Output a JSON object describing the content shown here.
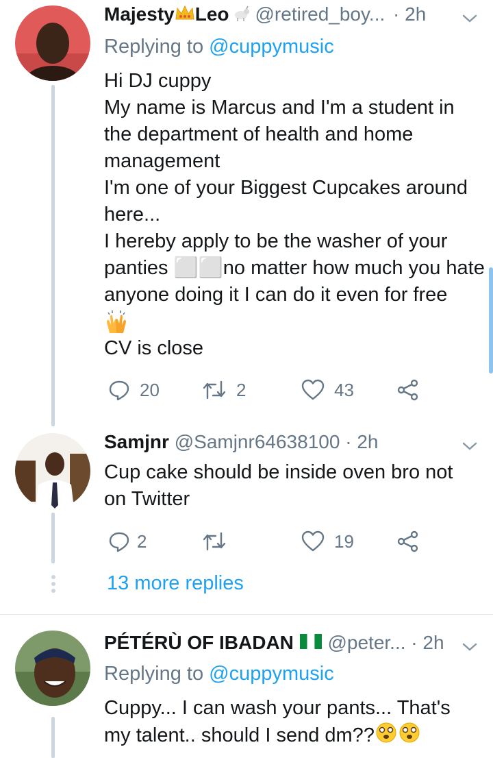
{
  "tweets": [
    {
      "name": "Majesty",
      "name_suffix": "Leo",
      "handle": "@retired_boy...",
      "time": "2h",
      "replying_prefix": "Replying to ",
      "replying_mention": "@cuppymusic",
      "lines": [
        "Hi DJ cuppy",
        "My name is Marcus and I'm a student in",
        "the department of health and home",
        "management",
        "I'm one of your Biggest Cupcakes around",
        "here...",
        "I hereby apply to be the washer of your",
        "panties ⬜⬜no matter how much you hate",
        "anyone doing it I can do it even for free",
        "",
        "CV is close"
      ],
      "replies": "20",
      "retweets": "2",
      "likes": "43"
    },
    {
      "name": "Samjnr",
      "handle": "@Samjnr64638100",
      "time": "2h",
      "lines": [
        "Cup cake should be inside oven bro not",
        "on Twitter"
      ],
      "replies": "2",
      "retweets": "",
      "likes": "19"
    },
    {
      "name": "PÉTÉRÙ OF IBADAN",
      "handle": "@peter...",
      "time": "2h",
      "replying_prefix": "Replying to ",
      "replying_mention": "@cuppymusic",
      "lines": [
        "Cuppy... I can wash your pants... That's",
        "my talent.. should I send dm??"
      ]
    }
  ],
  "more_replies": "13 more replies",
  "dot": "·",
  "colors": {
    "accent": "#1da1f2",
    "secondary_text": "#657786",
    "thread_line": "#ccd6dd"
  }
}
